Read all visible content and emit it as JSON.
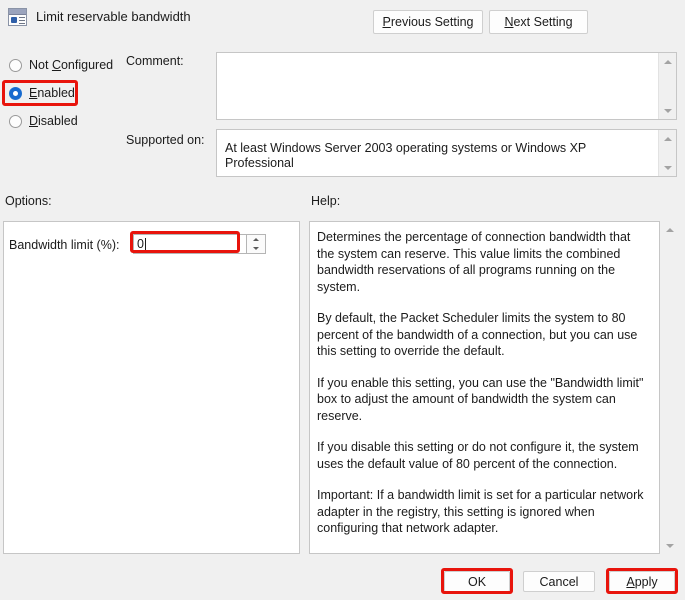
{
  "window": {
    "title": "Limit reservable bandwidth",
    "icon": "policy-setting-icon"
  },
  "nav": {
    "previous_label_pre": "P",
    "previous_label_post": "revious Setting",
    "next_label_pre": "N",
    "next_label_post": "ext Setting"
  },
  "state_options": {
    "not_configured": {
      "pre": "Not ",
      "accel": "C",
      "post": "onfigured",
      "selected": false
    },
    "enabled": {
      "pre": "",
      "accel": "E",
      "post": "nabled",
      "selected": true
    },
    "disabled": {
      "pre": "",
      "accel": "D",
      "post": "isabled",
      "selected": false
    }
  },
  "fields": {
    "comment_label": "Comment:",
    "comment_value": "",
    "supported_label": "Supported on:",
    "supported_value": "At least Windows Server 2003 operating systems or Windows XP Professional"
  },
  "sections": {
    "options_label": "Options:",
    "help_label": "Help:"
  },
  "options": {
    "bandwidth_label": "Bandwidth limit (%):",
    "bandwidth_value": "0"
  },
  "help": {
    "paragraphs": [
      "Determines the percentage of connection bandwidth that the system can reserve. This value limits the combined bandwidth reservations of all programs running on the system.",
      "By default, the Packet Scheduler limits the system to 80 percent of the bandwidth of a connection, but you can use this setting to override the default.",
      "If you enable this setting, you can use the \"Bandwidth limit\" box to adjust the amount of bandwidth the system can reserve.",
      "If you disable this setting or do not configure it, the system uses the default value of 80 percent of the connection.",
      "Important: If a bandwidth limit is set for a particular network adapter in the registry, this setting is ignored when configuring that network adapter."
    ]
  },
  "actions": {
    "ok_label": "OK",
    "cancel_label": "Cancel",
    "apply_accel": "A",
    "apply_post": "pply"
  },
  "colors": {
    "annotation_red": "#e8140c",
    "radio_selected_blue": "#1669cf",
    "window_background": "#f0f0f0"
  }
}
